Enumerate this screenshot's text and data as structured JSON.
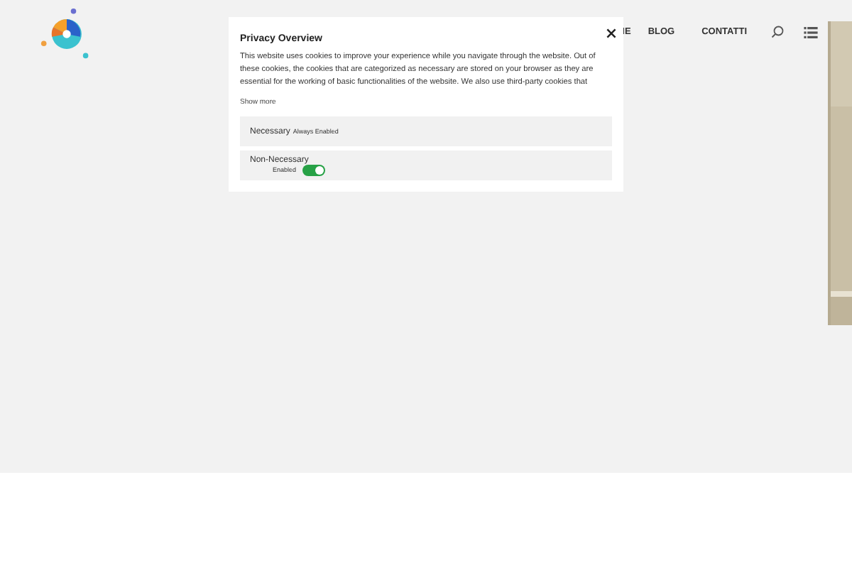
{
  "nav": {
    "items": [
      "IE",
      "BLOG",
      "CONTATTI"
    ]
  },
  "privacy_modal": {
    "title": "Privacy Overview",
    "body": "This website uses cookies to improve your experience while you navigate through the website. Out of these cookies, the cookies that are categorized as necessary are stored on your browser as they are essential for the working of basic functionalities of the website. We also use third-party cookies that",
    "show_more": "Show more",
    "categories": [
      {
        "kind": "fixed",
        "name": "Necessary",
        "status": "Always Enabled"
      },
      {
        "kind": "toggle",
        "name": "Non-Necessary",
        "status": "Enabled",
        "on": true
      }
    ]
  }
}
